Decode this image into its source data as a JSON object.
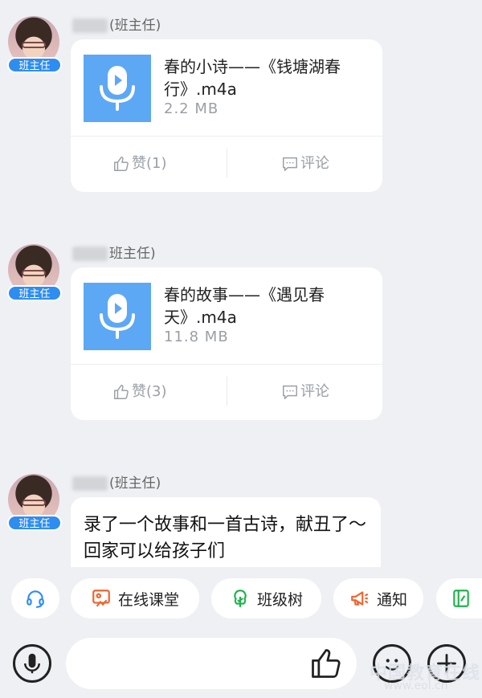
{
  "messages": [
    {
      "role": "班主任",
      "sender_suffix": "(班主任)",
      "file_name": "春的小诗——《钱塘湖春行》.m4a",
      "file_size": "2.2 MB",
      "like_label": "赞(1)",
      "comment_label": "评论"
    },
    {
      "role": "班主任",
      "sender_suffix": "班主任)",
      "file_name": "春的故事——《遇见春天》.m4a",
      "file_size": "11.8 MB",
      "like_label": "赞(3)",
      "comment_label": "评论"
    },
    {
      "role": "班主任",
      "sender_suffix": "(班主任)",
      "text": "录了一个故事和一首古诗，献丑了～回家可以给孩子们"
    }
  ],
  "quickbar": {
    "items": [
      {
        "label": "",
        "icon": "headset-icon"
      },
      {
        "label": "在线课堂",
        "icon": "online-class-icon"
      },
      {
        "label": "班级树",
        "icon": "tree-icon"
      },
      {
        "label": "通知",
        "icon": "megaphone-icon"
      },
      {
        "label": "",
        "icon": "notebook-icon"
      }
    ]
  },
  "inputbar": {
    "placeholder": ""
  },
  "watermark": {
    "main": "中国教育在线",
    "sub": "www.eol.cn"
  },
  "colors": {
    "accent_blue": "#2e8df0",
    "file_icon_blue": "#5ca8f4",
    "muted_gray": "#9aa0a6",
    "background": "#eef0f3",
    "orange": "#f0642c",
    "green": "#21b34d"
  }
}
